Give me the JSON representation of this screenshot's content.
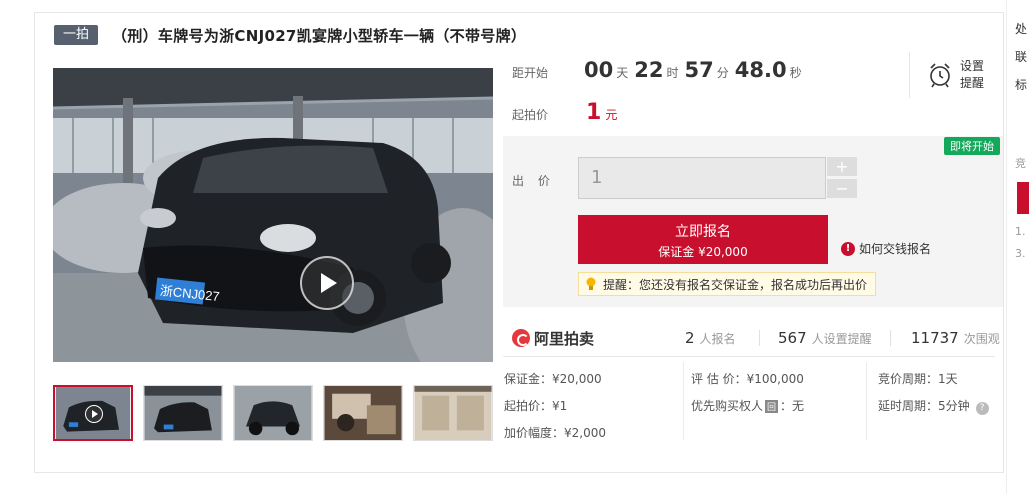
{
  "title": {
    "tag": "一拍",
    "text": "（刑）车牌号为浙CNJ027凯宴牌小型轿车一辆（不带号牌）"
  },
  "media": {
    "main_image": "porsche-cayenne-photo",
    "plate_text": "浙CNJ027",
    "thumbnails": [
      "video-thumb",
      "front-view",
      "rear-view",
      "interior-front",
      "interior-rear"
    ]
  },
  "countdown": {
    "label": "距开始",
    "days": "00",
    "days_unit": "天",
    "hours": "22",
    "hours_unit": "时",
    "minutes": "57",
    "minutes_unit": "分",
    "seconds": "48.0",
    "seconds_unit": "秒"
  },
  "remind": {
    "label": "设置提醒",
    "icon": "alarm-clock-icon"
  },
  "start_price": {
    "label": "起拍价",
    "value": "1",
    "unit": "元"
  },
  "bid": {
    "badge": "即将开始",
    "label": "出 价",
    "input_value": "1",
    "plus": "+",
    "minus": "−",
    "register_label": "立即报名",
    "deposit_label": "保证金 ¥20,000",
    "how_to_pay": "如何交钱报名",
    "tip": "提醒：您还没有报名交保证金，报名成功后再出价"
  },
  "stats": {
    "logo_text": "阿里拍卖",
    "registered_count": "2",
    "registered_label": "人报名",
    "reminder_count": "567",
    "reminder_label": "人设置提醒",
    "views_count": "11737",
    "views_label": "次围观"
  },
  "details": {
    "deposit": "保证金：¥20,000",
    "start_price": "起拍价：¥1",
    "increment": "加价幅度：¥2,000",
    "appraisal": "评 估 价：¥100,000",
    "priority_prefix": "优先购买权人",
    "priority_badge": "回",
    "priority_suffix": "：无",
    "cycle": "竞价周期：1天",
    "extension": "延时周期：5分钟"
  },
  "right_strip": {
    "item1": "处",
    "item2": "联",
    "item3": "标",
    "item4": "竞",
    "item5": "1.",
    "item6": "3."
  },
  "colors": {
    "accent": "#c8102e",
    "badge_green": "#14a85b",
    "tag_bg": "#56606f",
    "panel_bg": "#f4f4f4"
  }
}
